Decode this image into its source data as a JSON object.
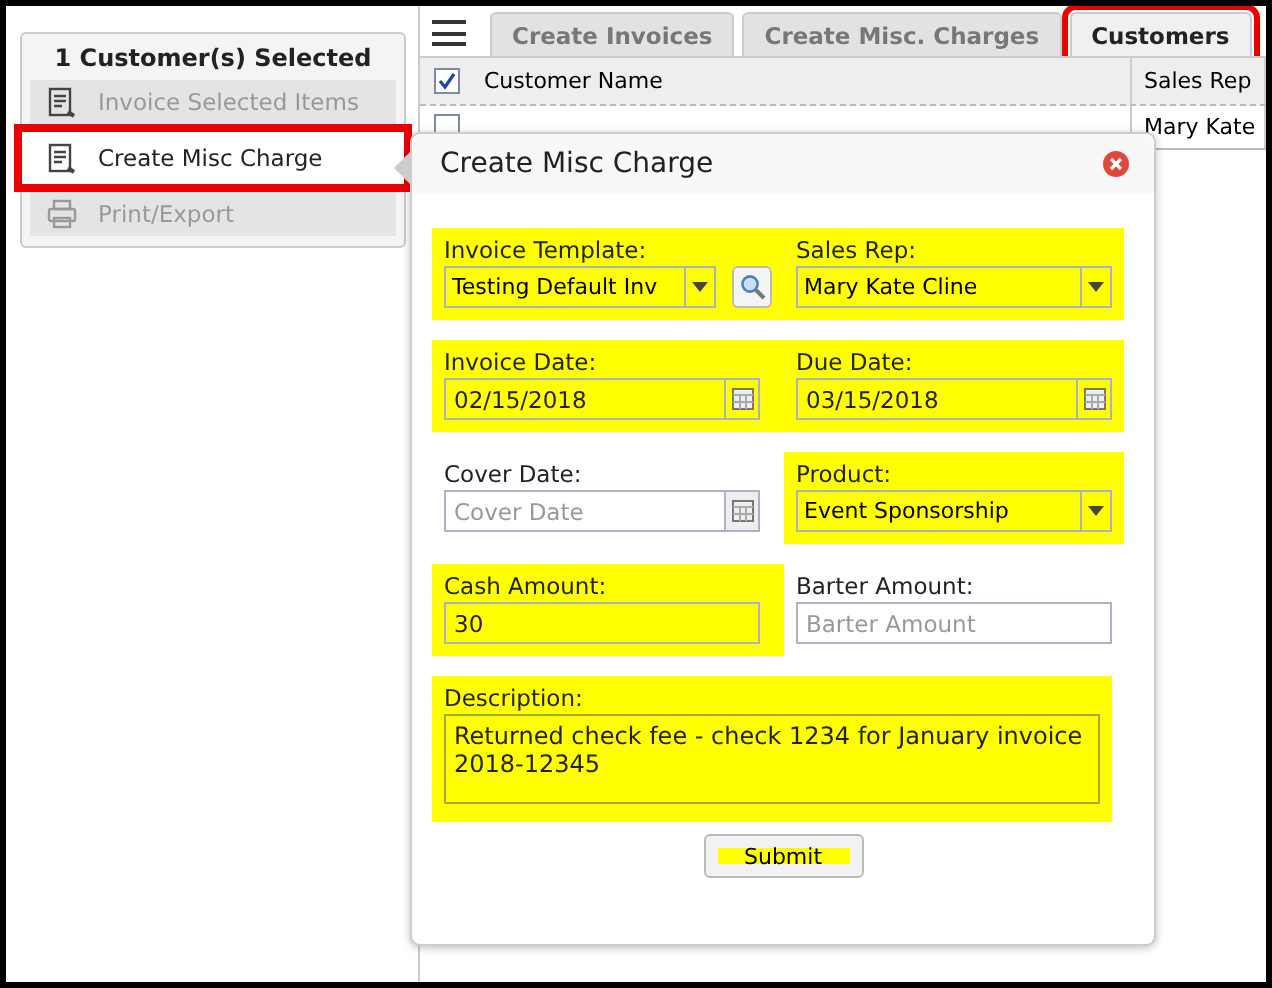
{
  "sidebar": {
    "title": "1 Customer(s) Selected",
    "items": [
      {
        "label": "Invoice Selected Items",
        "disabled": true,
        "annotated": false
      },
      {
        "label": "Create Misc Charge",
        "disabled": false,
        "annotated": true
      },
      {
        "label": "Print/Export",
        "disabled": true,
        "annotated": false
      }
    ]
  },
  "tabs": [
    {
      "label": "Create Invoices",
      "selected": false,
      "annotated": false
    },
    {
      "label": "Create Misc. Charges",
      "selected": false,
      "annotated": false
    },
    {
      "label": "Customers",
      "selected": true,
      "annotated": true
    }
  ],
  "table": {
    "select_all_checked": true,
    "columns": [
      "Customer Name",
      "Sales Rep"
    ],
    "rows": [
      {
        "checked": false,
        "cells": [
          "",
          "Mary Kate"
        ]
      }
    ]
  },
  "dialog": {
    "title": "Create Misc Charge",
    "fields": [
      {
        "kind": "select",
        "label": "Invoice Template:",
        "value": "Testing Default Inv",
        "lookup": true,
        "highlighted": true
      },
      {
        "kind": "select",
        "label": "Sales Rep:",
        "value": "Mary Kate Cline",
        "highlighted": true
      },
      {
        "kind": "date",
        "label": "Invoice Date:",
        "value": "02/15/2018",
        "highlighted": true
      },
      {
        "kind": "date",
        "label": "Due Date:",
        "value": "03/15/2018",
        "highlighted": true
      },
      {
        "kind": "date",
        "label": "Cover Date:",
        "placeholder": "Cover Date",
        "highlighted": false
      },
      {
        "kind": "select",
        "label": "Product:",
        "value": "Event Sponsorship",
        "highlighted": true
      },
      {
        "kind": "text",
        "label": "Cash Amount:",
        "value": "30",
        "highlighted": true
      },
      {
        "kind": "text",
        "label": "Barter Amount:",
        "placeholder": "Barter Amount",
        "highlighted": false
      },
      {
        "kind": "textarea",
        "label": "Description:",
        "value": "Returned check fee - check 1234 for January invoice 2018-12345",
        "highlighted": true
      }
    ],
    "submit": {
      "label": "Submit",
      "highlighted": true
    }
  }
}
